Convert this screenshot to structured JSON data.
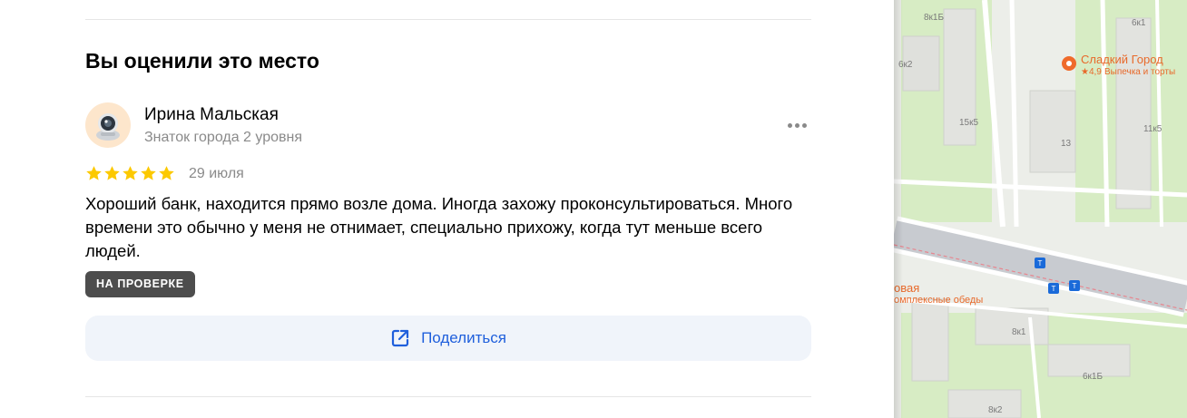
{
  "review_section": {
    "title": "Вы оценили это место",
    "author": {
      "name": "Ирина Мальская",
      "level": "Знаток города 2 уровня"
    },
    "rating": 5,
    "date": "29 июля",
    "text": "Хороший банк, находится прямо возле дома. Иногда захожу проконсультироваться. Много времени это обычно у меня не отнимает, специально прихожу, когда тут меньше всего людей.",
    "status_badge": "НА ПРОВЕРКЕ",
    "share_label": "Поделиться"
  },
  "colors": {
    "star": "#fcc900",
    "accent": "#1f5fdc",
    "badge_bg": "#4d4d4d",
    "share_bg": "#f0f4fa"
  },
  "icons": [
    "avatar-robot-icon",
    "more-options-icon",
    "star-icon",
    "share-icon",
    "cafe-pin-icon",
    "transit-stop-icon"
  ],
  "map": {
    "labels": {
      "b1": "8к1Б",
      "b2": "6к1",
      "b3": "6к2",
      "b4": "15к5",
      "b5": "13",
      "b6": "11к5",
      "b7": "8к1",
      "b8": "6к1Б",
      "b9": "8к2"
    },
    "poi": {
      "name": "Сладкий Город",
      "rating": "★4,9",
      "category": "Выпечка и торты"
    },
    "poi2": {
      "name": "овая",
      "subtitle": "омплексные обеды"
    }
  }
}
